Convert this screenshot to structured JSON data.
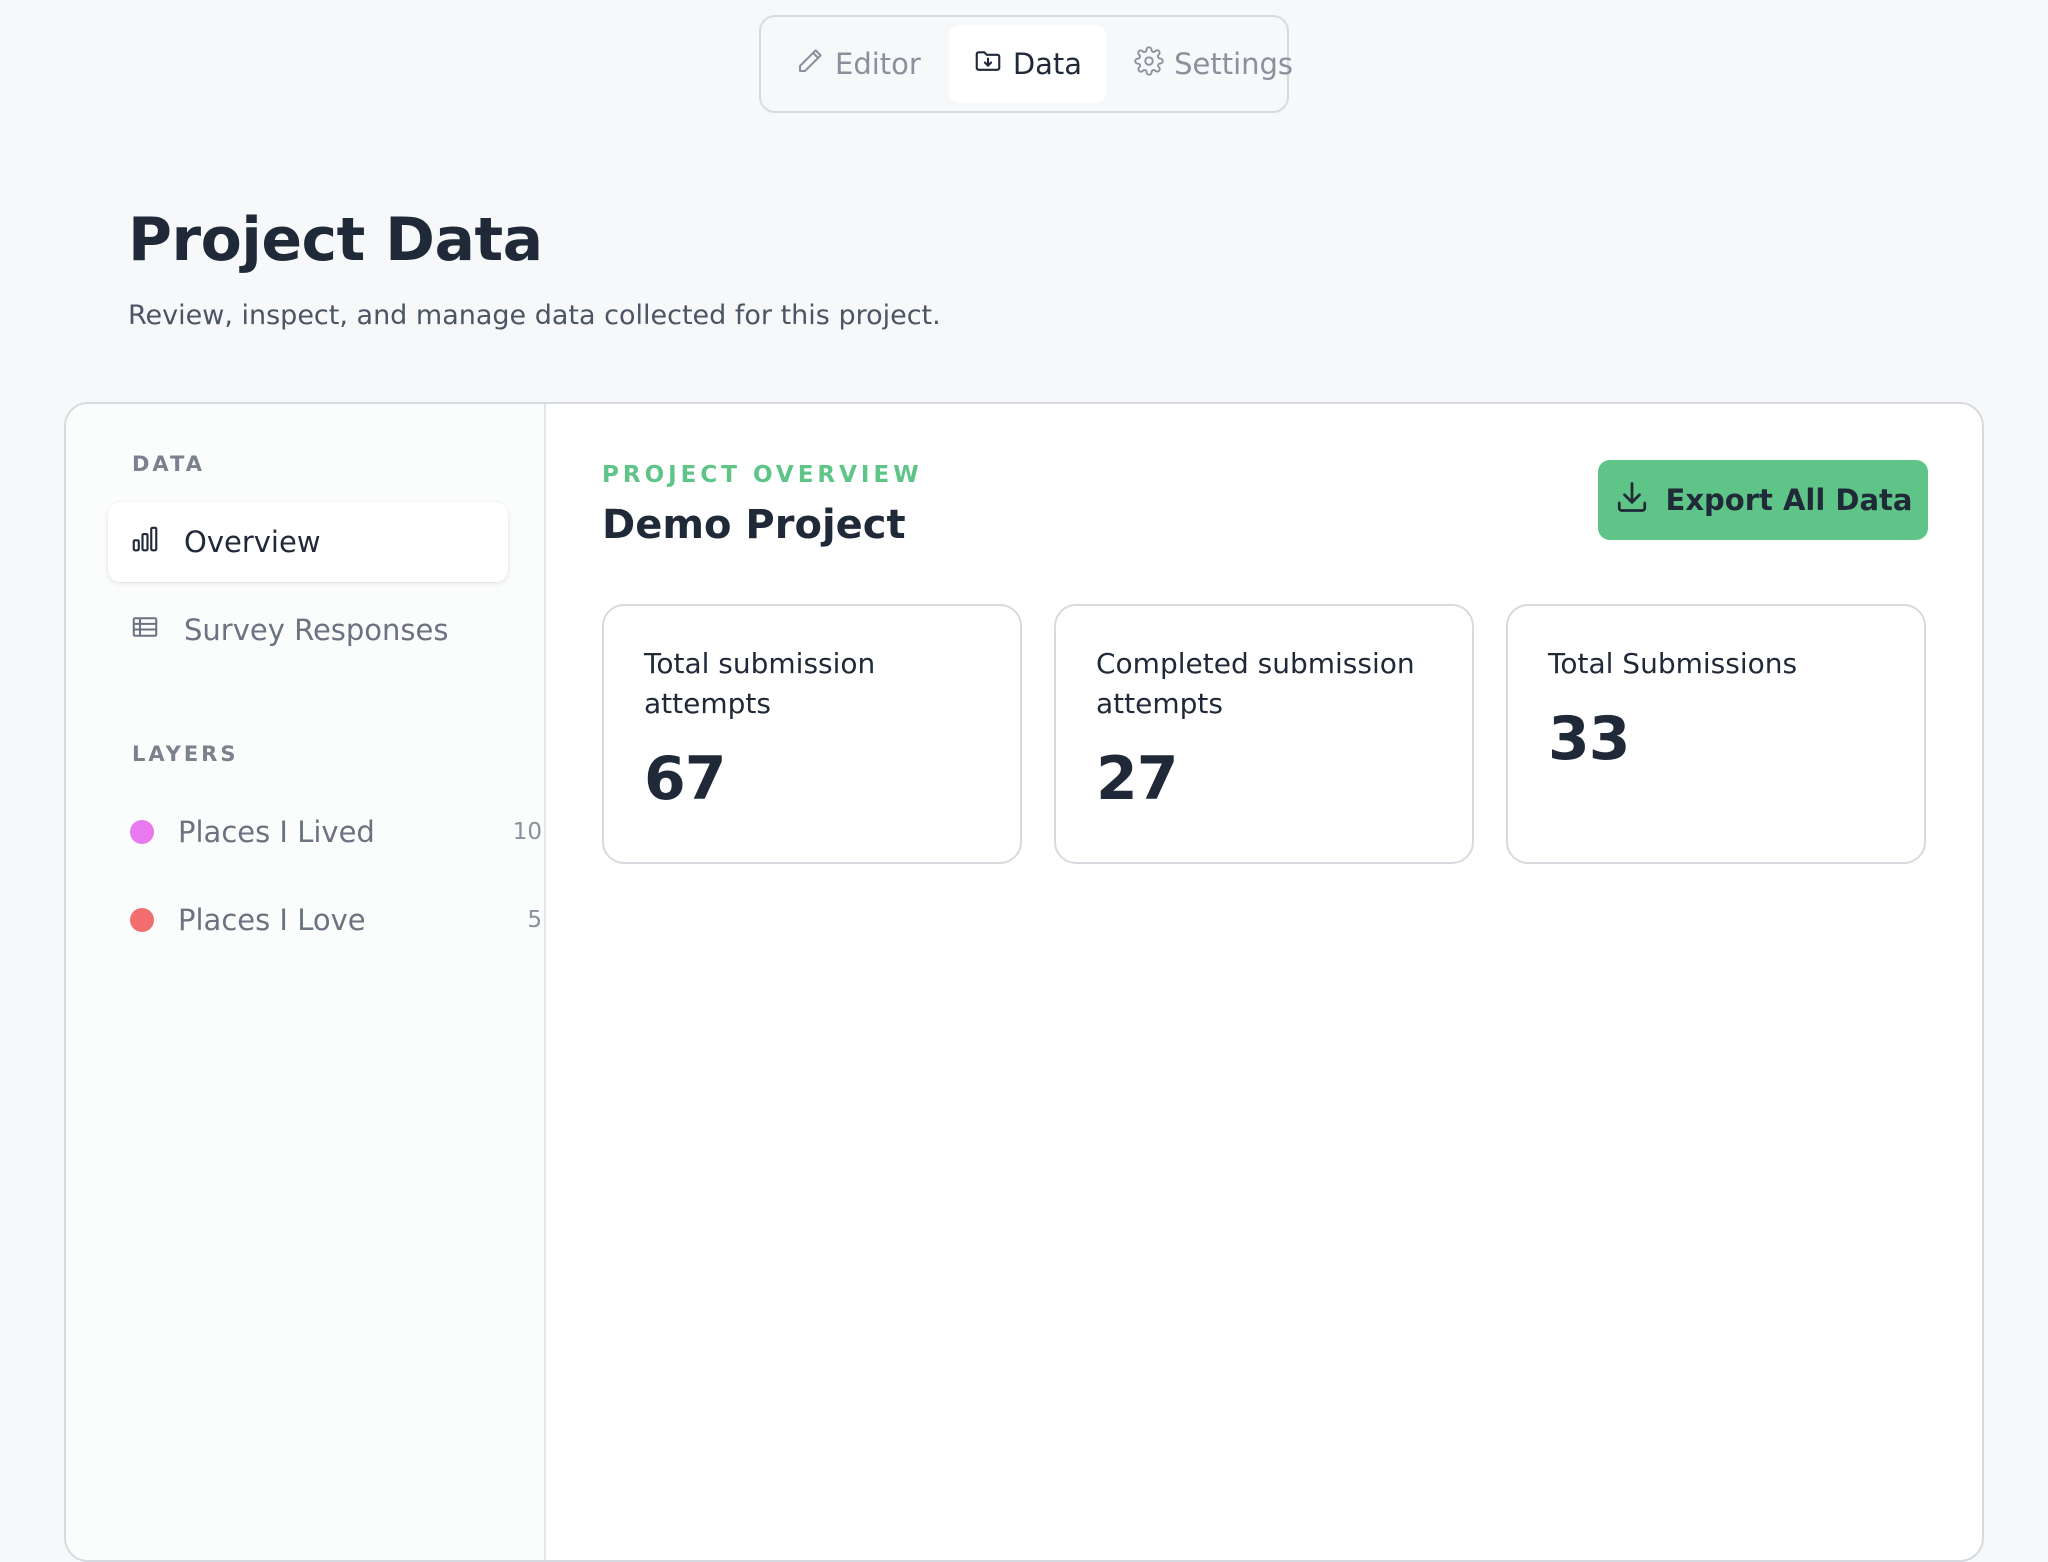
{
  "top_tabs": {
    "editor": {
      "label": "Editor",
      "icon": "pencil-icon"
    },
    "data": {
      "label": "Data",
      "icon": "folder-download-icon",
      "active": true
    },
    "settings": {
      "label": "Settings",
      "icon": "gear-icon"
    }
  },
  "header": {
    "title": "Project Data",
    "subtitle": "Review, inspect, and manage data collected for this project."
  },
  "sidebar": {
    "data_section_label": "DATA",
    "data_items": [
      {
        "label": "Overview",
        "icon": "bar-chart-icon",
        "active": true
      },
      {
        "label": "Survey Responses",
        "icon": "table-icon",
        "active": false
      }
    ],
    "layers_section_label": "LAYERS",
    "layers": [
      {
        "name": "Places I Lived",
        "count": "10",
        "color": "#e879f0"
      },
      {
        "name": "Places I Love",
        "count": "5",
        "color": "#f26d6d"
      }
    ]
  },
  "main": {
    "overview_label": "PROJECT OVERVIEW",
    "project_name": "Demo Project",
    "export_button": {
      "label": "Export All Data",
      "icon": "download-icon"
    },
    "stats": [
      {
        "label": "Total submission attempts",
        "value": "67"
      },
      {
        "label": "Completed submission attempts",
        "value": "27"
      },
      {
        "label": "Total Submissions",
        "value": "33"
      }
    ]
  },
  "colors": {
    "accent_green": "#5ec487",
    "text_dark": "#1f2937",
    "text_muted": "#6b7280",
    "border": "#d7dbe0",
    "background": "#f7f8fa"
  }
}
